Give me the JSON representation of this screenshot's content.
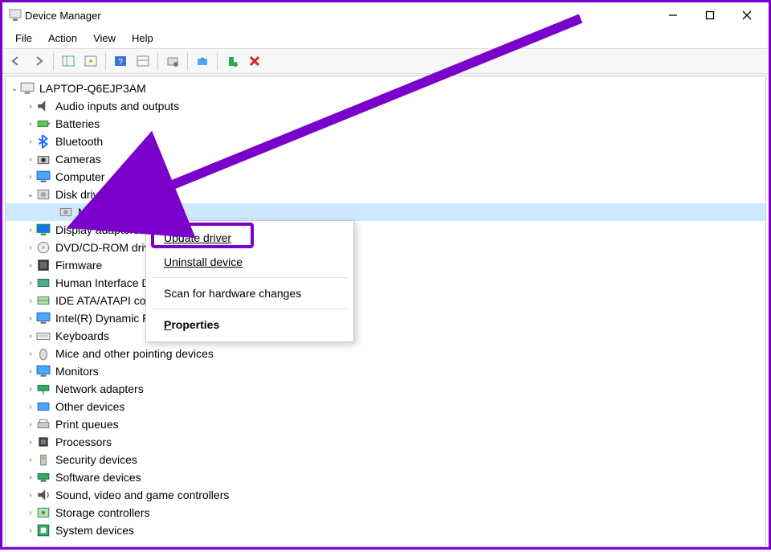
{
  "window": {
    "title": "Device Manager"
  },
  "menus": {
    "file": "File",
    "action": "Action",
    "view": "View",
    "help": "Help"
  },
  "toolbar": {
    "back": "back-arrow",
    "forward": "forward-arrow",
    "b1": "show-hide-tree",
    "b2": "show-hide-panes",
    "b3": "help",
    "b4": "properties",
    "b5": "print",
    "b6": "update-driver",
    "b7": "uninstall",
    "b8": "disable"
  },
  "tree": {
    "root": {
      "label": "LAPTOP-Q6EJP3AM",
      "icon": "computer"
    },
    "items": [
      {
        "label": "Audio inputs and outputs",
        "icon": "speaker"
      },
      {
        "label": "Batteries",
        "icon": "battery"
      },
      {
        "label": "Bluetooth",
        "icon": "bluetooth"
      },
      {
        "label": "Cameras",
        "icon": "camera"
      },
      {
        "label": "Computer",
        "icon": "monitor"
      },
      {
        "label": "Disk drives",
        "icon": "disk",
        "expanded": true,
        "children": [
          {
            "label": "MTFDDAK256TBN",
            "icon": "disk-inner",
            "selected": true
          }
        ]
      },
      {
        "label": "Display adapters",
        "icon": "display"
      },
      {
        "label": "DVD/CD-ROM drives",
        "icon": "dvd"
      },
      {
        "label": "Firmware",
        "icon": "firmware"
      },
      {
        "label": "Human Interface Devices",
        "icon": "hid"
      },
      {
        "label": "IDE ATA/ATAPI controllers",
        "icon": "ide"
      },
      {
        "label": "Intel(R) Dynamic Platform and Thermal Framework",
        "icon": "intel"
      },
      {
        "label": "Keyboards",
        "icon": "keyboard"
      },
      {
        "label": "Mice and other pointing devices",
        "icon": "mouse"
      },
      {
        "label": "Monitors",
        "icon": "monitor2"
      },
      {
        "label": "Network adapters",
        "icon": "network"
      },
      {
        "label": "Other devices",
        "icon": "other"
      },
      {
        "label": "Print queues",
        "icon": "printer"
      },
      {
        "label": "Processors",
        "icon": "cpu"
      },
      {
        "label": "Security devices",
        "icon": "security"
      },
      {
        "label": "Software devices",
        "icon": "software"
      },
      {
        "label": "Sound, video and game controllers",
        "icon": "sound"
      },
      {
        "label": "Storage controllers",
        "icon": "storage"
      },
      {
        "label": "System devices",
        "icon": "system"
      }
    ]
  },
  "context_menu": {
    "update": "Update driver",
    "uninstall": "Uninstall device",
    "scan": "Scan for hardware changes",
    "properties": "Properties"
  }
}
